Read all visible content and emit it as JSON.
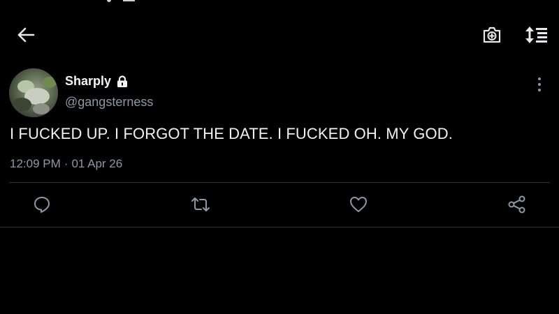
{
  "tweet": {
    "author_name": "Sharply",
    "author_handle": "@gangsterness",
    "text": "I FUCKED UP. I FORGOT THE DATE. I FUCKED OH. MY GOD.",
    "time": "12:09 PM",
    "separator": "·",
    "date": "01 Apr 26"
  },
  "icons": {
    "back": "arrow-left-icon",
    "camera": "camera-plus-icon",
    "sort": "sort-list-icon",
    "lock": "lock-icon",
    "more": "more-vertical-icon",
    "reply": "reply-bubble-icon",
    "retweet": "retweet-icon",
    "like": "heart-icon",
    "share": "share-icon"
  },
  "colors": {
    "background": "#000000",
    "text_primary": "#f2f2f2",
    "text_secondary": "#8b98a5",
    "divider": "#2f3336"
  }
}
